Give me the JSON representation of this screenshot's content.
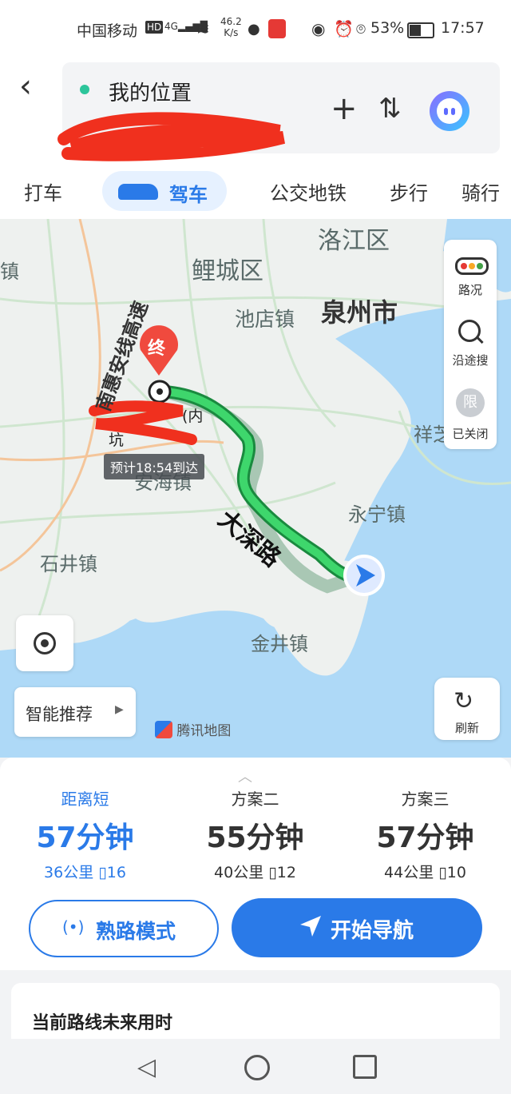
{
  "status_bar": {
    "carrier": "中国移动",
    "network_speed": "46.2",
    "network_unit": "K/s",
    "battery": "53%",
    "time": "17:57"
  },
  "search": {
    "origin": "我的位置"
  },
  "mode_tabs": [
    {
      "label": "打车"
    },
    {
      "label": "驾车"
    },
    {
      "label": "公交地铁"
    },
    {
      "label": "步行"
    },
    {
      "label": "骑行"
    }
  ],
  "map": {
    "labels": [
      "洛江区",
      "鲤城区",
      "泉州市",
      "池店镇",
      "南惠安线高速",
      "祥芝",
      "永宁镇",
      "石井镇",
      "金井镇",
      "安海镇",
      "大深路",
      "镇"
    ],
    "destination_marker": "终",
    "destination_text": "(内",
    "destination_text2": "坑",
    "eta": "预计18:54到达",
    "tools": [
      {
        "label": "路况"
      },
      {
        "label": "沿途搜"
      },
      {
        "label": "已关闭",
        "icon_text": "限"
      }
    ],
    "smart_recommend": "智能推荐",
    "refresh": "刷新",
    "brand": "腾讯地图"
  },
  "plans": [
    {
      "name": "距离短",
      "time": "57分钟",
      "distance": "36公里",
      "lights": "16",
      "active": true
    },
    {
      "name": "方案二",
      "time": "55分钟",
      "distance": "40公里",
      "lights": "12",
      "active": false
    },
    {
      "name": "方案三",
      "time": "57分钟",
      "distance": "44公里",
      "lights": "10",
      "active": false
    }
  ],
  "actions": {
    "familiar_mode": "熟路模式",
    "start_nav": "开始导航"
  },
  "future_section": {
    "title": "当前路线未来用时"
  },
  "colors": {
    "accent": "#2a7ae8",
    "route": "#2fc46a",
    "water": "#aed9f7"
  }
}
